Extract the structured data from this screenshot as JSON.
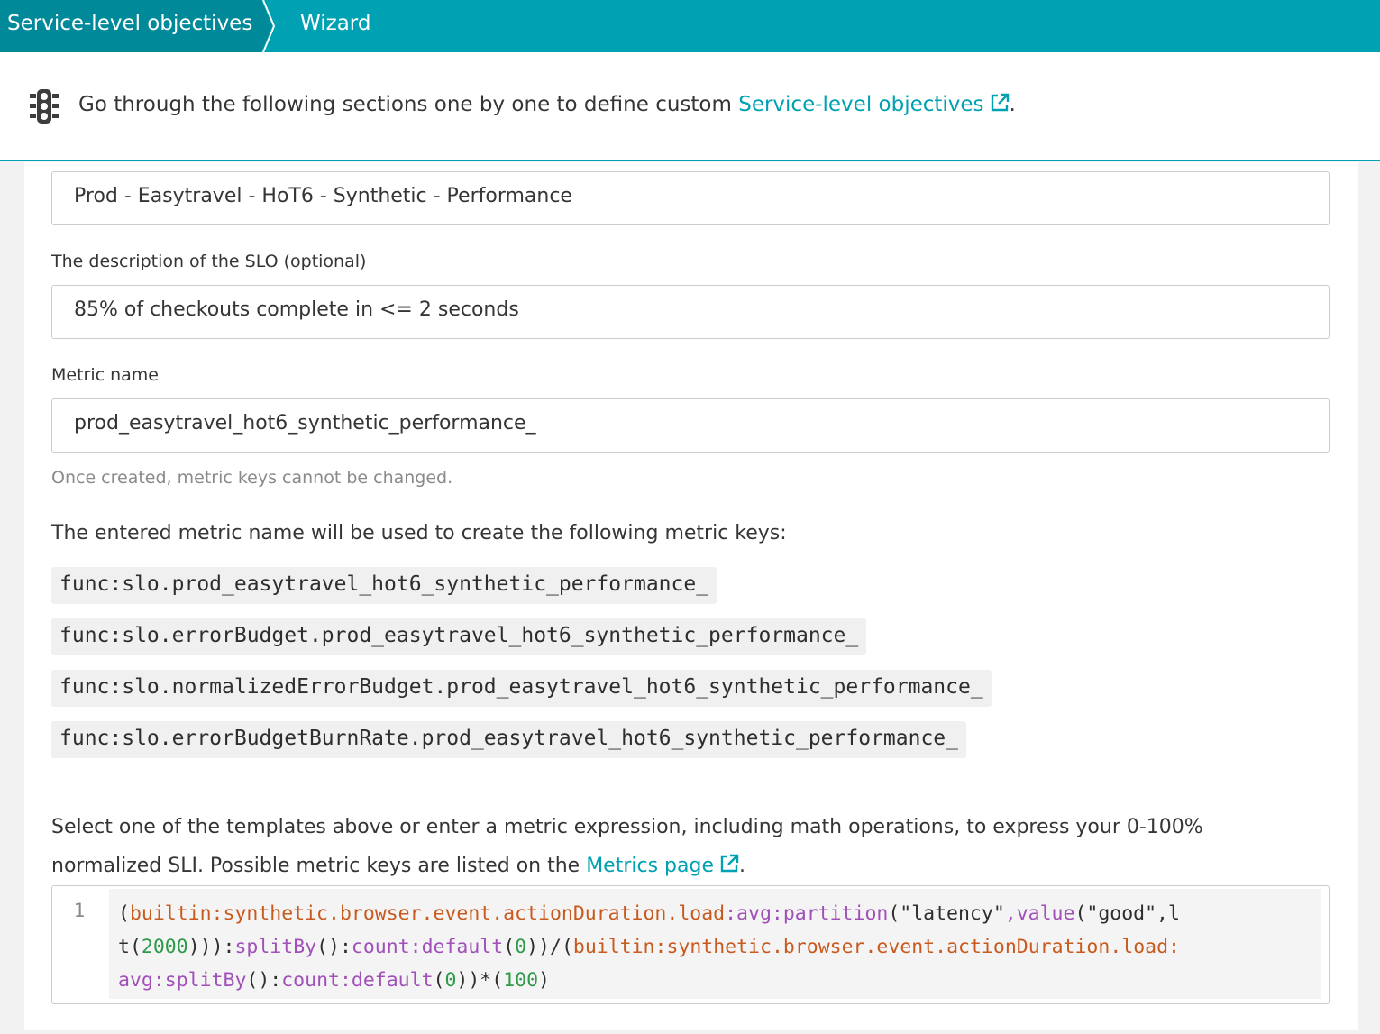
{
  "breadcrumb": {
    "items": [
      "Service-level objectives",
      "Wizard"
    ]
  },
  "intro": {
    "icon": "traffic-light-icon",
    "text_before": "Go through the following sections one by one to define custom",
    "link_label": "Service-level objectives",
    "text_after": "."
  },
  "form": {
    "slo_name_value": "Prod - Easytravel - HoT6 - Synthetic - Performance",
    "description_label": "The description of the SLO (optional)",
    "description_value": "85% of checkouts complete in <= 2 seconds",
    "metric_name_label": "Metric name",
    "metric_name_value": "prod_easytravel_hot6_synthetic_performance_",
    "metric_hint": "Once created, metric keys cannot be changed.",
    "metric_keys_intro": "The entered metric name will be used to create the following metric keys:",
    "metric_keys": [
      "func:slo.prod_easytravel_hot6_synthetic_performance_",
      "func:slo.errorBudget.prod_easytravel_hot6_synthetic_performance_",
      "func:slo.normalizedErrorBudget.prod_easytravel_hot6_synthetic_performance_",
      "func:slo.errorBudgetBurnRate.prod_easytravel_hot6_synthetic_performance_"
    ],
    "expression_help_line1": "Select one of the templates above or enter a metric expression, including math operations, to express your 0-100%",
    "expression_help_line2_before": "normalized SLI. Possible metric keys are listed on the",
    "expression_help_link": "Metrics page",
    "expression_help_after": "."
  },
  "editor": {
    "line_number": "1",
    "lines": [
      [
        {
          "t": "(",
          "c": "plain"
        },
        {
          "t": "builtin:synthetic.browser.event.actionDuration.load",
          "c": "key"
        },
        {
          "t": ":avg:partition",
          "c": "fn"
        },
        {
          "t": "(\"latency\"",
          "c": "plain"
        },
        {
          "t": ",value",
          "c": "fn"
        },
        {
          "t": "(\"good\",l",
          "c": "plain"
        }
      ],
      [
        {
          "t": "t",
          "c": "plain"
        },
        {
          "t": "(",
          "c": "plain"
        },
        {
          "t": "2000",
          "c": "num"
        },
        {
          "t": "))):",
          "c": "plain"
        },
        {
          "t": "splitBy",
          "c": "fn"
        },
        {
          "t": "():",
          "c": "plain"
        },
        {
          "t": "count:default",
          "c": "fn"
        },
        {
          "t": "(",
          "c": "plain"
        },
        {
          "t": "0",
          "c": "num"
        },
        {
          "t": "))/(",
          "c": "plain"
        },
        {
          "t": "builtin:synthetic.browser.event.actionDuration.load:",
          "c": "key"
        }
      ],
      [
        {
          "t": "avg:splitBy",
          "c": "fn"
        },
        {
          "t": "():",
          "c": "plain"
        },
        {
          "t": "count:default",
          "c": "fn"
        },
        {
          "t": "(",
          "c": "plain"
        },
        {
          "t": "0",
          "c": "num"
        },
        {
          "t": "))*(",
          "c": "plain"
        },
        {
          "t": "100",
          "c": "num"
        },
        {
          "t": ")",
          "c": "plain"
        }
      ]
    ]
  },
  "colors": {
    "accent": "#00a1b2",
    "accent_dark": "#008a99",
    "code_key": "#c85a1e",
    "code_fn": "#a050b8",
    "code_num": "#2e9a4a"
  }
}
